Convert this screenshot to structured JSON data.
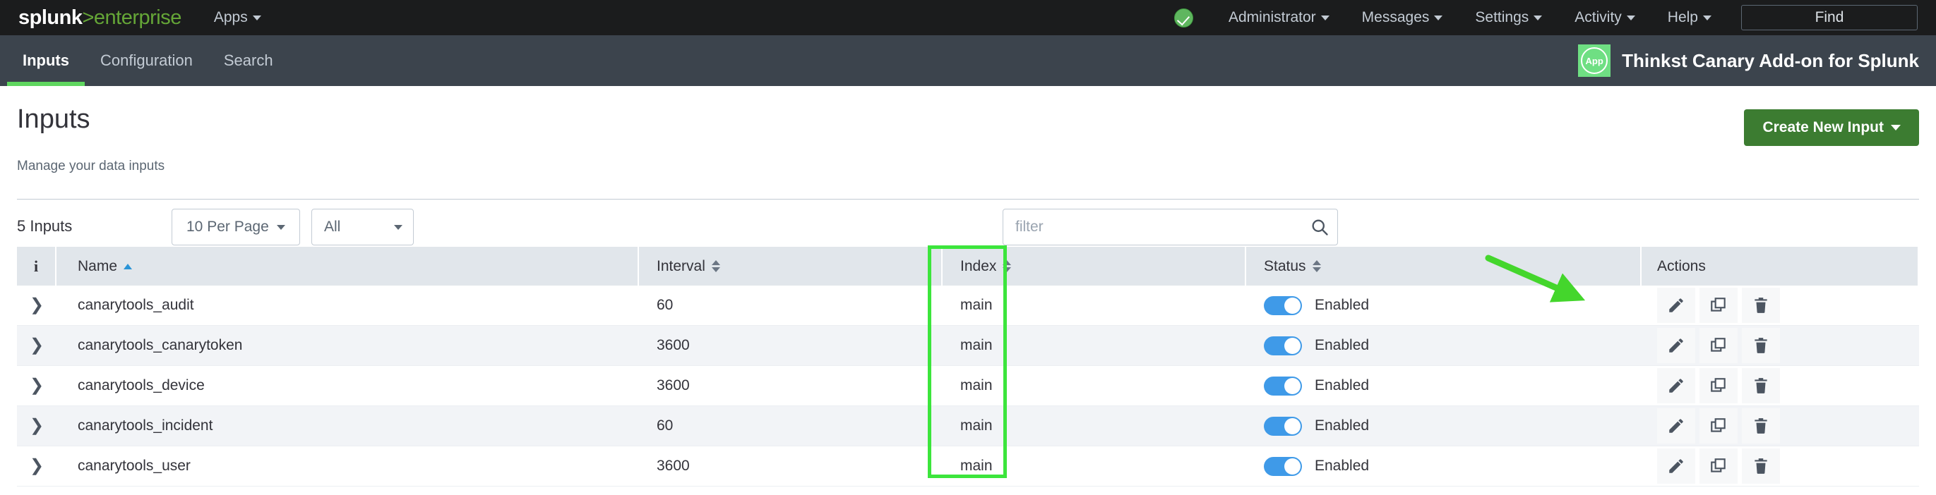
{
  "topbar": {
    "logo_white": "splunk",
    "logo_green": ">enterprise",
    "apps_label": "Apps",
    "health_icon": "health-check-icon",
    "menu": [
      {
        "label": "Administrator",
        "name": "administrator"
      },
      {
        "label": "Messages",
        "name": "messages"
      },
      {
        "label": "Settings",
        "name": "settings"
      },
      {
        "label": "Activity",
        "name": "activity"
      },
      {
        "label": "Help",
        "name": "help"
      }
    ],
    "find_label": "Find"
  },
  "appbar": {
    "tabs": [
      {
        "label": "Inputs",
        "active": true
      },
      {
        "label": "Configuration",
        "active": false
      },
      {
        "label": "Search",
        "active": false
      }
    ],
    "app_badge_text": "App",
    "app_title": "Thinkst Canary Add-on for Splunk"
  },
  "page": {
    "title": "Inputs",
    "subtitle": "Manage your data inputs",
    "create_button": "Create New Input"
  },
  "controls": {
    "count_label": "5 Inputs",
    "per_page": "10 Per Page",
    "scope": "All",
    "filter_placeholder": "filter",
    "search_icon": "search-icon"
  },
  "table": {
    "columns": [
      {
        "label": "",
        "sort": "none",
        "name": "info"
      },
      {
        "label": "Name",
        "sort": "asc",
        "name": "name"
      },
      {
        "label": "Interval",
        "sort": "both",
        "name": "interval"
      },
      {
        "label": "Index",
        "sort": "both",
        "name": "index"
      },
      {
        "label": "Status",
        "sort": "both",
        "name": "status"
      },
      {
        "label": "Actions",
        "sort": "none",
        "name": "actions"
      }
    ],
    "rows": [
      {
        "name": "canarytools_audit",
        "interval": "60",
        "index": "main",
        "status": "Enabled",
        "enabled": true
      },
      {
        "name": "canarytools_canarytoken",
        "interval": "3600",
        "index": "main",
        "status": "Enabled",
        "enabled": true
      },
      {
        "name": "canarytools_device",
        "interval": "3600",
        "index": "main",
        "status": "Enabled",
        "enabled": true
      },
      {
        "name": "canarytools_incident",
        "interval": "60",
        "index": "main",
        "status": "Enabled",
        "enabled": true
      },
      {
        "name": "canarytools_user",
        "interval": "3600",
        "index": "main",
        "status": "Enabled",
        "enabled": true
      }
    ],
    "row_actions": [
      "edit-pencil-icon",
      "clone-icon",
      "delete-trash-icon"
    ]
  },
  "annotations": {
    "highlight_color": "#3ce53c",
    "arrow_color": "#44d62c",
    "highlight_target": "index-column",
    "arrow_target": "first-row-edit-button"
  },
  "colors": {
    "topbar_bg": "#1b1c1d",
    "appbar_bg": "#3c444d",
    "accent_green": "#65a637",
    "create_button_bg": "#3c7c31",
    "toggle_on": "#3f9ae8",
    "sort_active": "#2a94d6"
  }
}
